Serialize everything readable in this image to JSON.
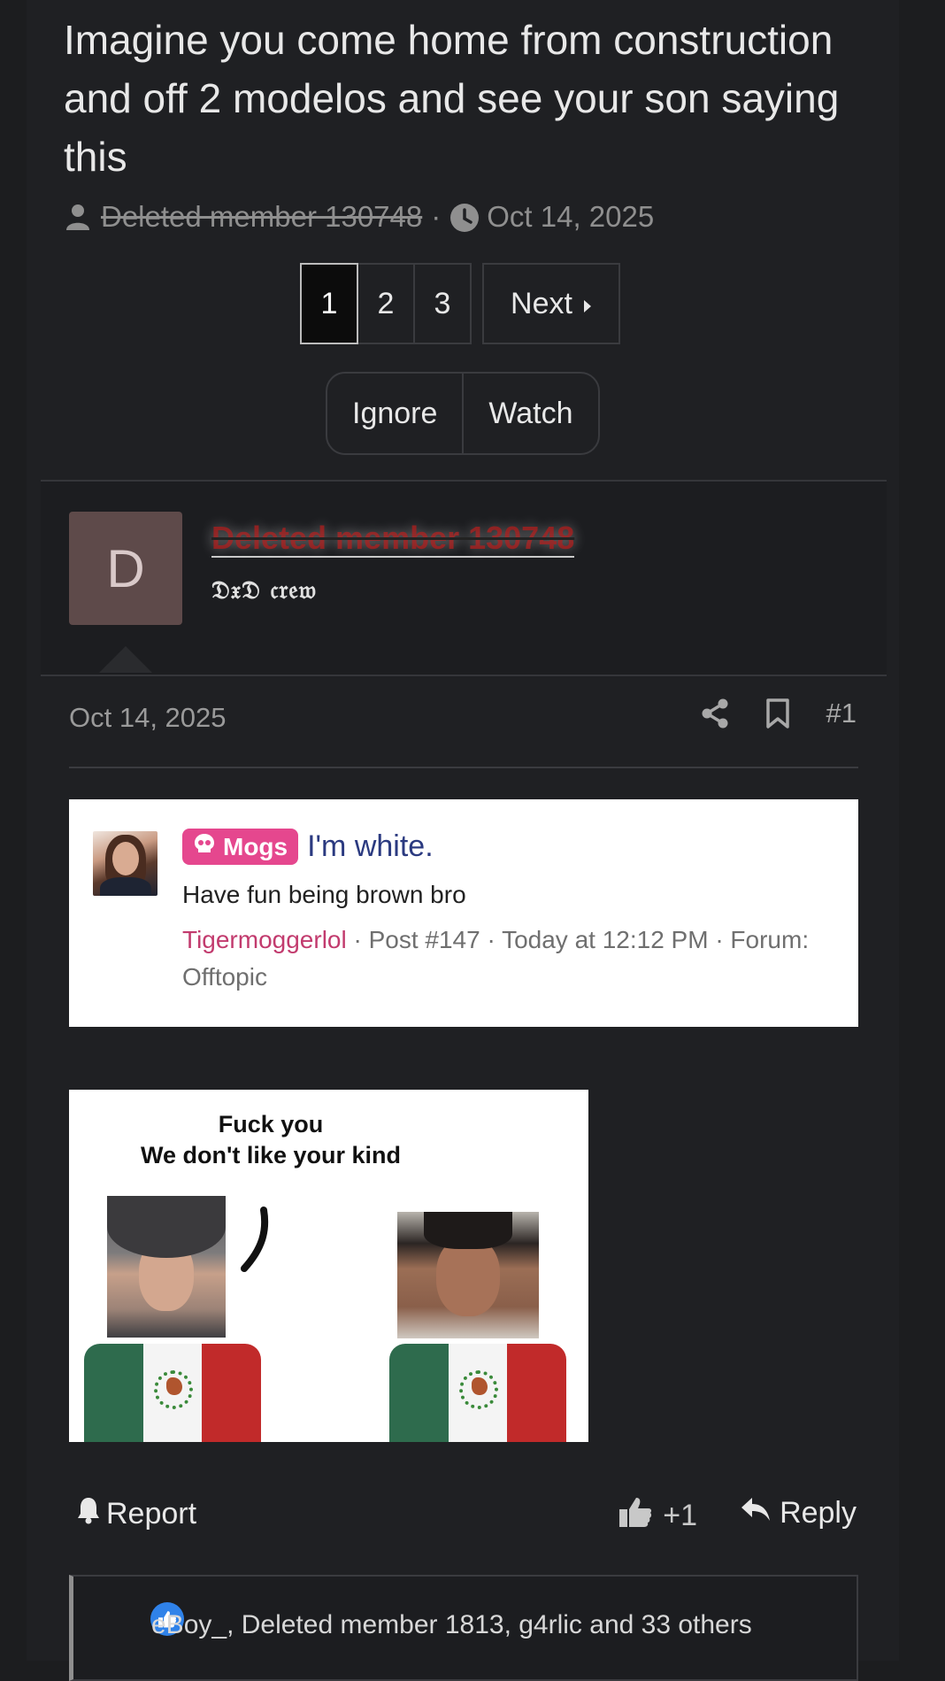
{
  "thread": {
    "title": "Imagine you come home from construction and off 2 modelos and see your son saying this",
    "author": "Deleted member 130748",
    "separator": "·",
    "date": "Oct 14, 2025"
  },
  "pagination": {
    "pages": [
      "1",
      "2",
      "3"
    ],
    "active": "1",
    "next_label": "Next"
  },
  "thread_actions": {
    "ignore_label": "Ignore",
    "watch_label": "Watch"
  },
  "post": {
    "avatar_letter": "D",
    "username": "Deleted member 130748",
    "user_title": "𝔇𝔵𝔇 𝔠𝔯𝔢𝔴",
    "date": "Oct 14, 2025",
    "post_number": "#1",
    "quote": {
      "badge": "Mogs",
      "title": "I'm white.",
      "text": "Have fun being brown bro",
      "author": "Tigermoggerlol",
      "meta": " · Post #147 · Today at 12:12 PM · Forum: Offtopic"
    },
    "meme": {
      "caption_line1": "Fuck you",
      "caption_line2": "We don't like your kind"
    },
    "actions": {
      "report_label": "Report",
      "like_label": "+1",
      "reply_label": "Reply"
    },
    "reactions": {
      "text": "eBoy_, Deleted member 1813, g4rlic and 33 others"
    }
  },
  "colors": {
    "background": "#1c1d1f",
    "badge": "#e5478e",
    "quote_author": "#c23b6e",
    "quote_title": "#2b3a80",
    "deleted_username": "#8e1f1f",
    "like_icon_bg": "#2f82e9"
  },
  "icons": {
    "author": "user-icon",
    "date": "clock-icon",
    "share": "share-icon",
    "bookmark": "bookmark-icon",
    "report": "bell-icon",
    "like": "thumbs-up-icon",
    "reply": "reply-icon"
  }
}
